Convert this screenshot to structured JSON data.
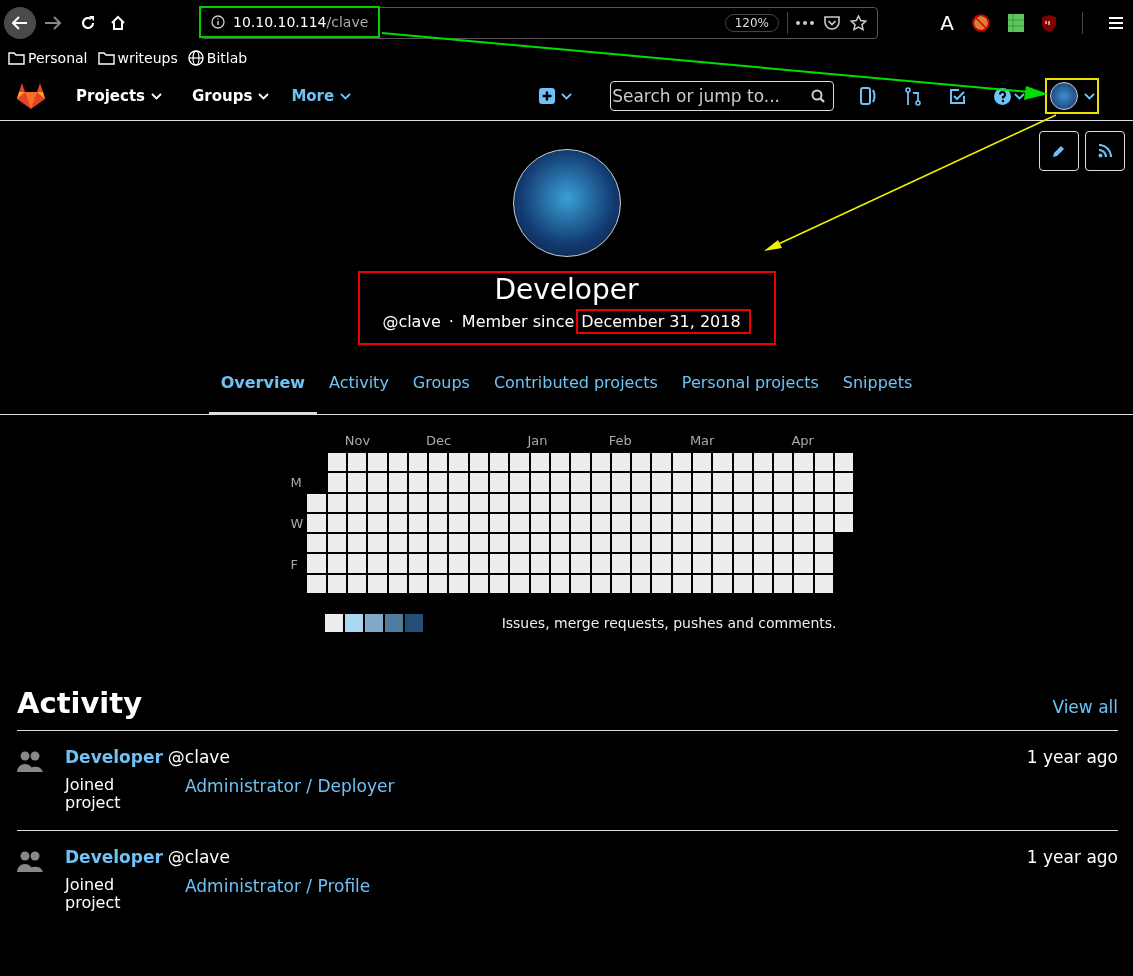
{
  "browser": {
    "url_host": "10.10.10.114",
    "url_path": "/clave",
    "zoom": "120%",
    "reader_glyph": "A",
    "bookmarks": [
      {
        "kind": "folder",
        "label": "Personal"
      },
      {
        "kind": "folder",
        "label": "writeups"
      },
      {
        "kind": "globe",
        "label": "Bitlab"
      }
    ]
  },
  "navbar": {
    "menus": [
      {
        "label": "Projects",
        "highlighted": false
      },
      {
        "label": "Groups",
        "highlighted": false
      },
      {
        "label": "More",
        "highlighted": true
      }
    ],
    "search": {
      "placeholder": "Search or jump to..."
    }
  },
  "profile": {
    "name": "Developer",
    "username": "@clave",
    "separator": "·",
    "member_since": "Member since",
    "date": "December 31, 2018"
  },
  "tabs": [
    {
      "label": "Overview",
      "selected": true
    },
    {
      "label": "Activity",
      "selected": false
    },
    {
      "label": "Groups",
      "selected": false
    },
    {
      "label": "Contributed projects",
      "selected": false
    },
    {
      "label": "Personal projects",
      "selected": false
    },
    {
      "label": "Snippets",
      "selected": false
    }
  ],
  "calendar": {
    "months": [
      "Nov",
      "Dec",
      "Jan",
      "Feb",
      "Mar",
      "Apr"
    ],
    "day_labels": [
      "M",
      "W",
      "F"
    ],
    "legend": [
      {
        "color": "#ededed"
      },
      {
        "color": "#acd5f2"
      },
      {
        "color": "#7fa8c9"
      },
      {
        "color": "#527ba0"
      },
      {
        "color": "#254e77"
      }
    ],
    "legend_text": "Issues, merge requests, pushes and comments."
  },
  "activity": {
    "title": "Activity",
    "view_all": "View all",
    "events": [
      {
        "author": "Developer",
        "username": "@clave",
        "action": "Joined project",
        "project": "Administrator / Deployer",
        "time": "1 year ago"
      },
      {
        "author": "Developer",
        "username": "@clave",
        "action": "Joined project",
        "project": "Administrator / Profile",
        "time": "1 year ago"
      }
    ]
  }
}
